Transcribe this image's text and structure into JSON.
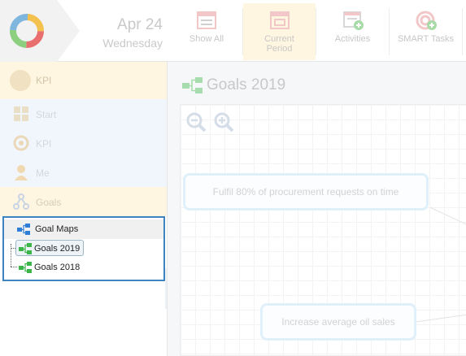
{
  "header": {
    "date_day": "Apr 24",
    "date_weekday": "Wednesday",
    "nav": [
      {
        "label": "Show All",
        "icon": "calendar-list-icon"
      },
      {
        "label": "Current Period",
        "icon": "calendar-current-icon"
      },
      {
        "label": "Activities",
        "icon": "activities-add-icon"
      },
      {
        "label": "SMART Tasks",
        "icon": "target-add-icon"
      }
    ]
  },
  "sidebar": {
    "kpi_header": "KPI",
    "items": [
      {
        "label": "Start",
        "icon": "grid-icon"
      },
      {
        "label": "KPI",
        "icon": "gauge-icon"
      },
      {
        "label": "Me",
        "icon": "person-icon"
      },
      {
        "label": "Goals",
        "icon": "goals-network-icon"
      }
    ],
    "tree": {
      "header": "Goal Maps",
      "children": [
        "Goals 2019",
        "Goals 2018"
      ]
    }
  },
  "main": {
    "title": "Goals 2019",
    "cards": [
      "Fulfil 80% of procurement requests on time",
      "Increase average oil sales"
    ]
  },
  "colors": {
    "selection_border": "#3e84c0",
    "tree_icon_green": "#3bb54a",
    "tree_icon_blue": "#2f7ed8"
  }
}
